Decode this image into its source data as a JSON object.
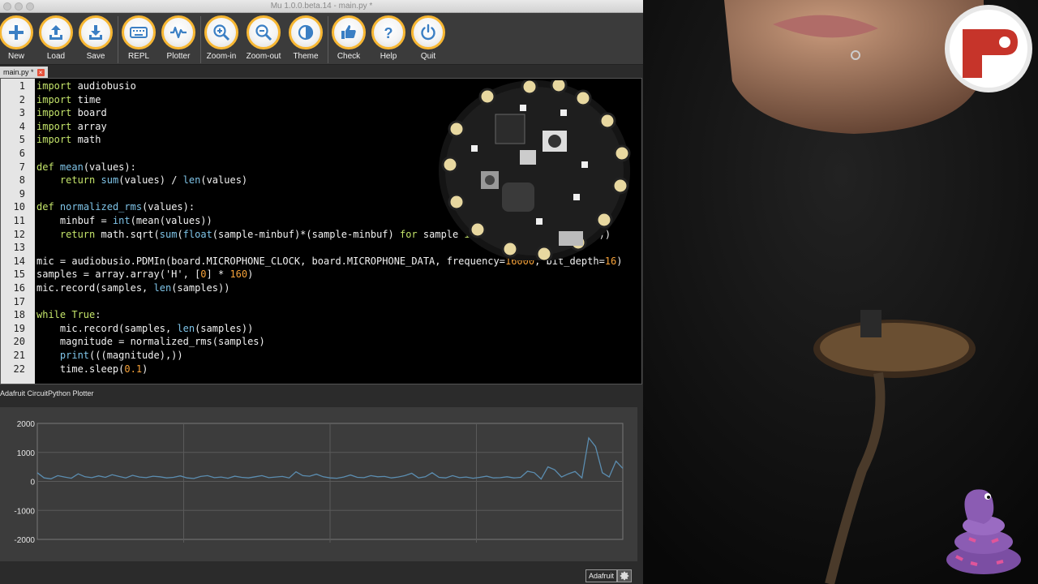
{
  "window": {
    "title": "Mu 1.0.0.beta.14 - main.py *"
  },
  "toolbar": {
    "buttons": [
      {
        "label": "New",
        "icon": "plus-icon"
      },
      {
        "label": "Load",
        "icon": "upload-icon"
      },
      {
        "label": "Save",
        "icon": "download-icon"
      },
      {
        "label": "REPL",
        "icon": "keyboard-icon"
      },
      {
        "label": "Plotter",
        "icon": "waveform-icon"
      },
      {
        "label": "Zoom-in",
        "icon": "zoom-in-icon"
      },
      {
        "label": "Zoom-out",
        "icon": "zoom-out-icon"
      },
      {
        "label": "Theme",
        "icon": "contrast-icon"
      },
      {
        "label": "Check",
        "icon": "thumbs-up-icon"
      },
      {
        "label": "Help",
        "icon": "question-icon"
      },
      {
        "label": "Quit",
        "icon": "power-icon"
      }
    ],
    "accent": "#f7b733"
  },
  "tab": {
    "label": "main.py *",
    "close": "×"
  },
  "editor": {
    "line_numbers": [
      "1",
      "2",
      "3",
      "4",
      "5",
      "6",
      "7",
      "8",
      "9",
      "10",
      "11",
      "12",
      "13",
      "14",
      "15",
      "16",
      "17",
      "18",
      "19",
      "20",
      "21",
      "22"
    ],
    "lines": [
      "import audiobusio",
      "import time",
      "import board",
      "import array",
      "import math",
      "",
      "def mean(values):",
      "    return sum(values) / len(values)",
      "",
      "def normalized_rms(values):",
      "    minbuf = int(mean(values))",
      "    return math.sqrt(sum(float(sample-minbuf)*(sample-minbuf) for sample in values) / len(values))",
      "",
      "mic = audiobusio.PDMIn(board.MICROPHONE_CLOCK, board.MICROPHONE_DATA, frequency=16000, bit_depth=16)",
      "samples = array.array('H', [0] * 160)",
      "mic.record(samples, len(samples))",
      "",
      "while True:",
      "    mic.record(samples, len(samples))",
      "    magnitude = normalized_rms(samples)",
      "    print(((magnitude),))",
      "    time.sleep(0.1)"
    ]
  },
  "plotter": {
    "title": "Adafruit CircuitPython Plotter"
  },
  "chart_data": {
    "type": "line",
    "title": "",
    "xlabel": "",
    "ylabel": "",
    "ylim": [
      -2000,
      2000
    ],
    "yticks": [
      "2000",
      "1000",
      "0",
      "-1000",
      "-2000"
    ],
    "grid": true,
    "series": [
      {
        "values": [
          300,
          120,
          90,
          200,
          150,
          110,
          260,
          160,
          130,
          190,
          140,
          230,
          170,
          120,
          210,
          150,
          130,
          180,
          160,
          120,
          140,
          190,
          120,
          100,
          170,
          200,
          130,
          150,
          110,
          180,
          140,
          120,
          160,
          200,
          130,
          150,
          170,
          120,
          330,
          200,
          180,
          250,
          160,
          120,
          110,
          150,
          220,
          140,
          130,
          200,
          160,
          170,
          120,
          150,
          200,
          280,
          120,
          160,
          300,
          140,
          120,
          200,
          130,
          150,
          110,
          140,
          180,
          120,
          130,
          160,
          120,
          140,
          350,
          300,
          80,
          500,
          400,
          150,
          260,
          340,
          120,
          1500,
          1200,
          300,
          150,
          700,
          450
        ],
        "color": "#5b8db0"
      }
    ]
  },
  "status": {
    "mode": "Adafruit"
  },
  "video": {
    "logo": "circuitpython-logo",
    "mascot": "blinka-snake"
  }
}
